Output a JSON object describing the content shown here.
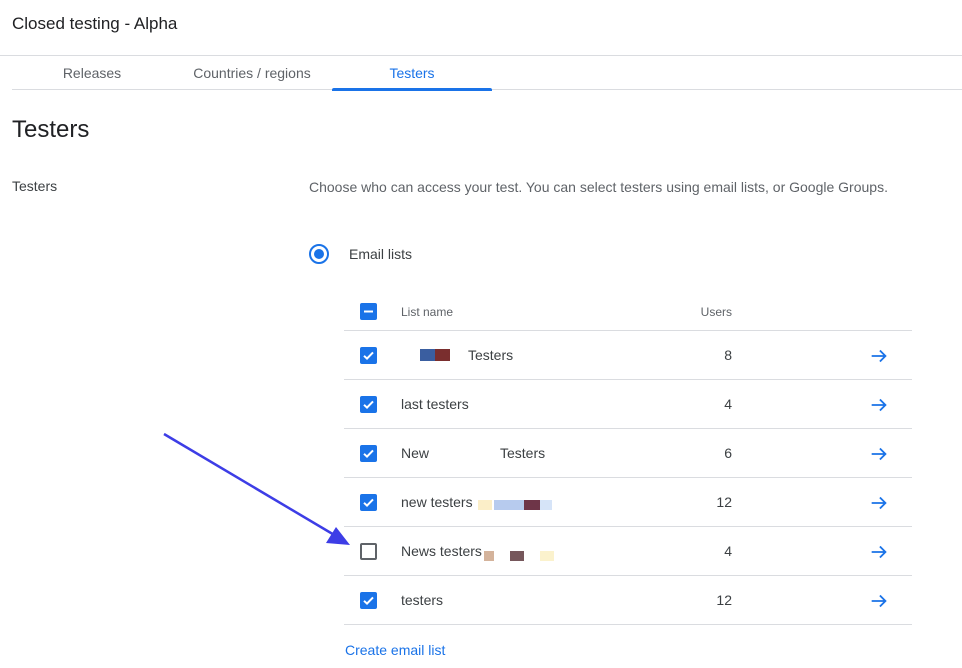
{
  "page_title": "Closed testing - Alpha",
  "tabs": [
    {
      "label": "Releases",
      "active": false
    },
    {
      "label": "Countries / regions",
      "active": false
    },
    {
      "label": "Testers",
      "active": true
    }
  ],
  "heading": "Testers",
  "section_label": "Testers",
  "description": "Choose who can access your test. You can select testers using email lists, or Google Groups.",
  "access_option": {
    "label": "Email lists",
    "selected": true
  },
  "table": {
    "headers": {
      "name": "List name",
      "users": "Users"
    },
    "select_all": "indeterminate",
    "rows": [
      {
        "name_prefix": "",
        "name": "Testers",
        "users": "8",
        "checked": true
      },
      {
        "name_prefix": "",
        "name": "last testers",
        "users": "4",
        "checked": true
      },
      {
        "name_prefix": "New",
        "name": "Testers",
        "users": "6",
        "checked": true
      },
      {
        "name_prefix": "",
        "name": "new testers",
        "users": "12",
        "checked": true
      },
      {
        "name_prefix": "",
        "name": "News testers",
        "users": "4",
        "checked": false
      },
      {
        "name_prefix": "",
        "name": "testers",
        "users": "12",
        "checked": true
      }
    ]
  },
  "create_link": "Create email list",
  "colors": {
    "accent": "#1a73e8",
    "annotation_arrow": "#3d3de6"
  },
  "icons": {
    "row_action": "arrow-forward-icon",
    "check": "check-icon",
    "indeterminate": "minus-icon"
  }
}
